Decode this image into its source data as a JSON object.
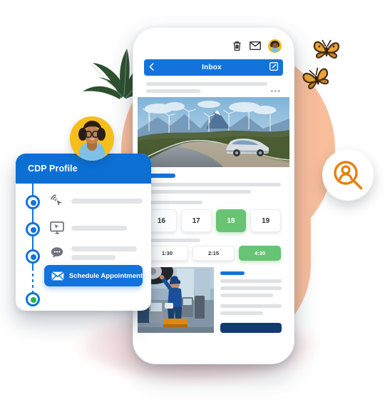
{
  "background": {
    "accent_circle_color": "#F8BE9C",
    "shadow_pink": "#F8AAAA"
  },
  "decorations": {
    "plant": "plant-leaves",
    "butterflies": [
      "butterfly-icon",
      "butterfly-icon"
    ],
    "woman_avatar": "woman-avatar",
    "search_badge": "person-search-icon"
  },
  "phone": {
    "topbar": {
      "trash": "trash-icon",
      "envelope": "envelope-icon",
      "avatar": "user-avatar-icon"
    },
    "inbox": {
      "back": "chevron-left-icon",
      "title": "Inbox",
      "compose": "compose-icon",
      "more": "•••"
    },
    "hero_image": "car-on-mountain-road-photo",
    "date_label": "",
    "dates": [
      {
        "label": "16",
        "selected": false
      },
      {
        "label": "17",
        "selected": false
      },
      {
        "label": "18",
        "selected": true
      },
      {
        "label": "19",
        "selected": false
      }
    ],
    "times": [
      {
        "label": "1:30",
        "selected": false
      },
      {
        "label": "2:15",
        "selected": false
      },
      {
        "label": "4:30",
        "selected": true
      }
    ],
    "bottom_image": "mechanic-working-photo",
    "bottom_cta": "",
    "selected_color": "#68C374",
    "accent_color": "#1274DB",
    "navy_color": "#123A73"
  },
  "cdp_card": {
    "title": "CDP Profile",
    "header_color": "#0B6FD4",
    "timeline": [
      {
        "icon": "click-target-icon",
        "state": "done"
      },
      {
        "icon": "monitor-cursor-icon",
        "state": "done"
      },
      {
        "icon": "chat-bubble-icon",
        "state": "done"
      },
      {
        "icon": "green-dot-icon",
        "state": "current"
      }
    ],
    "cta": {
      "icon": "envelope-icon",
      "label": "Schedule Appointment",
      "color": "#1372DB"
    }
  }
}
